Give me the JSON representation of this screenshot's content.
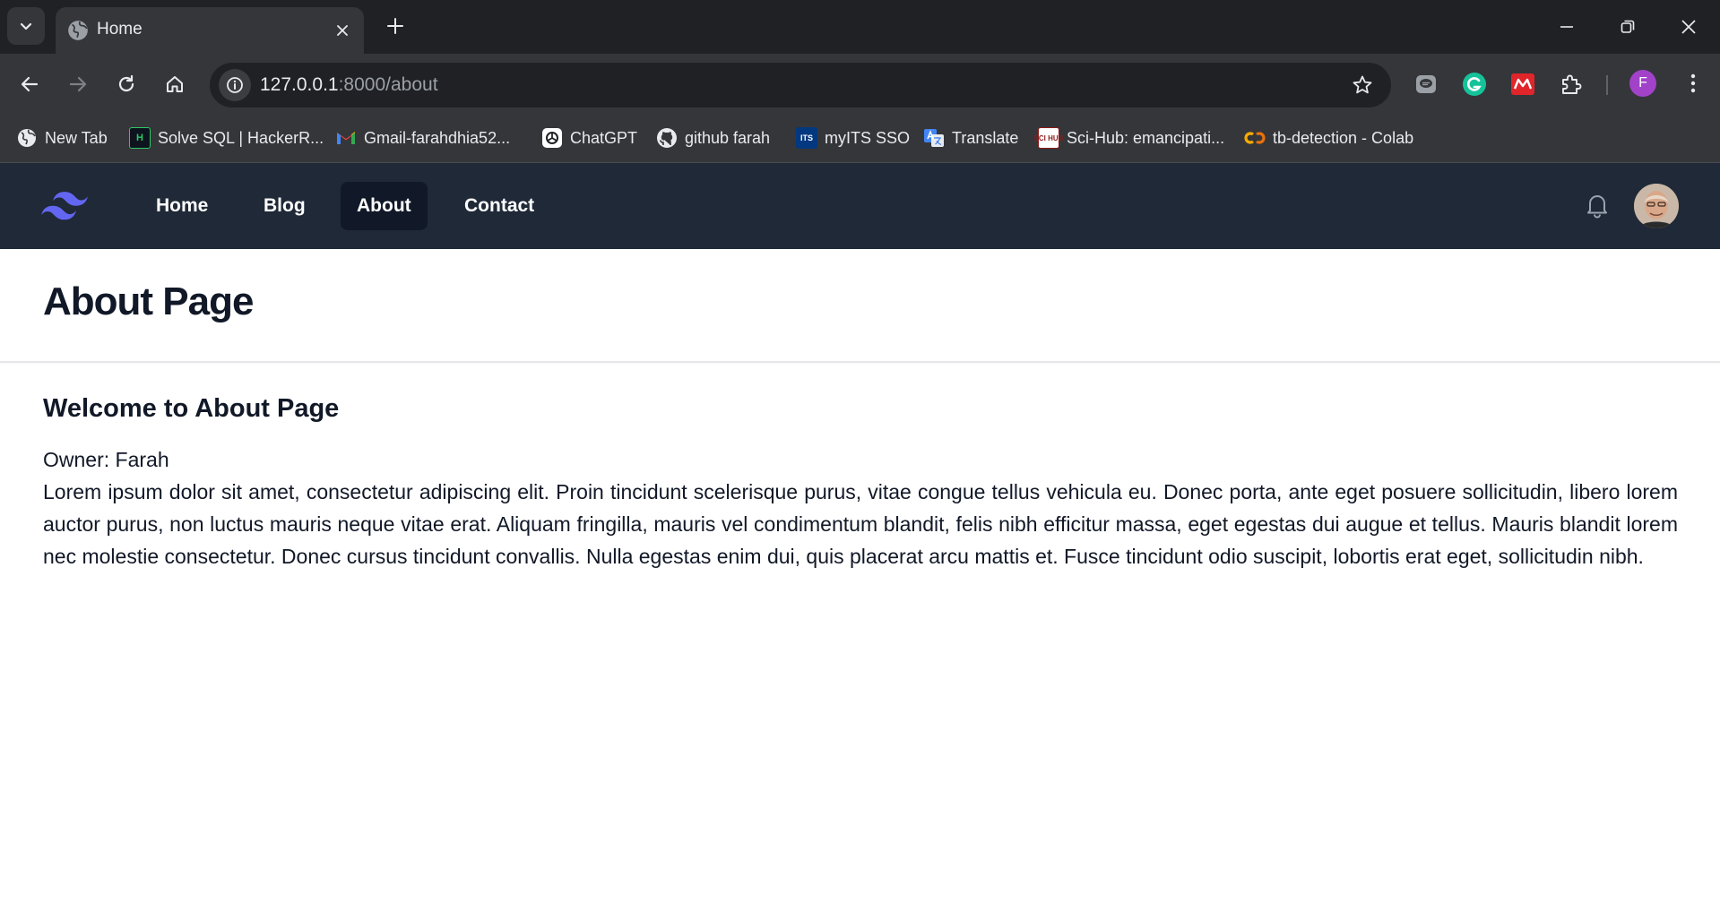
{
  "browser": {
    "tab_title": "Home",
    "url_host": "127.0.0.1",
    "url_path": ":8000/about",
    "profile_initial": "F",
    "bookmarks": [
      {
        "label": "New Tab",
        "icon": "globe-icon"
      },
      {
        "label": "Solve SQL | HackerR...",
        "icon": "hackerrank-icon"
      },
      {
        "label": "Gmail-farahdhia52...",
        "icon": "gmail-icon"
      },
      {
        "label": "ChatGPT",
        "icon": "chatgpt-icon"
      },
      {
        "label": "github farah",
        "icon": "github-icon"
      },
      {
        "label": "myITS SSO",
        "icon": "its-icon"
      },
      {
        "label": "Translate",
        "icon": "translate-icon"
      },
      {
        "label": "Sci-Hub: emancipati...",
        "icon": "scihub-icon"
      },
      {
        "label": "tb-detection - Colab",
        "icon": "colab-icon"
      }
    ],
    "bookmark_icon_text": {
      "hackerrank": "H",
      "its": "ITS",
      "scihub": "SCI HUB"
    }
  },
  "nav": {
    "links": [
      {
        "label": "Home"
      },
      {
        "label": "Blog"
      },
      {
        "label": "About"
      },
      {
        "label": "Contact"
      }
    ],
    "active": "About",
    "colors": {
      "bg": "#1f2937",
      "active_bg": "#111827",
      "logo": "#6366f1"
    }
  },
  "header": {
    "title": "About Page"
  },
  "main": {
    "welcome": "Welcome to About Page",
    "owner": "Owner: Farah",
    "body": "Lorem ipsum dolor sit amet, consectetur adipiscing elit. Proin tincidunt scelerisque purus, vitae congue tellus vehicula eu. Donec porta, ante eget posuere sollicitudin, libero lorem auctor purus, non luctus mauris neque vitae erat. Aliquam fringilla, mauris vel condimentum blandit, felis nibh efficitur massa, eget egestas dui augue et tellus. Mauris blandit lorem nec molestie consectetur. Donec cursus tincidunt convallis. Nulla egestas enim dui, quis placerat arcu mattis et. Fusce tincidunt odio suscipit, lobortis erat eget, sollicitudin nibh."
  }
}
